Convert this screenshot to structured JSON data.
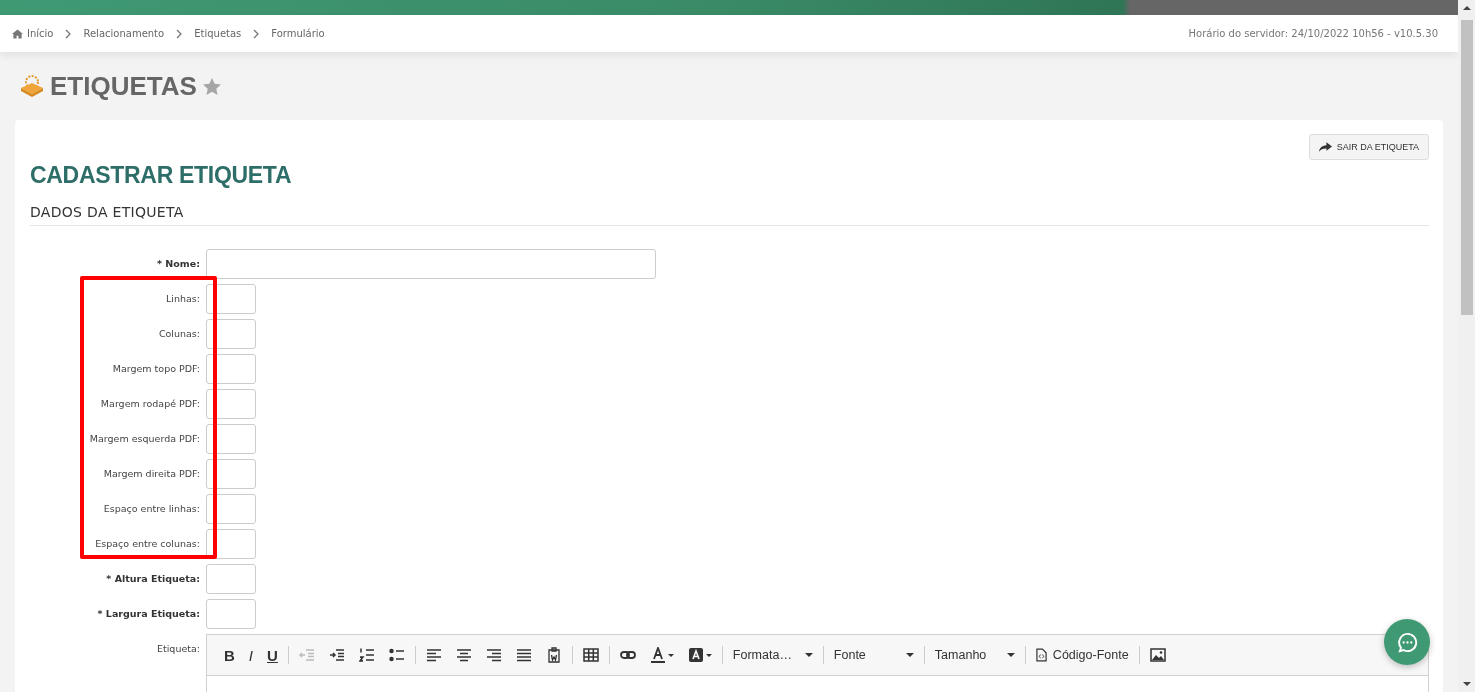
{
  "breadcrumb": [
    {
      "label": "Início",
      "kind": "home"
    },
    {
      "label": "Relacionamento"
    },
    {
      "label": "Etiquetas"
    },
    {
      "label": "Formulário"
    }
  ],
  "server_info": "Horário do servidor: 24/10/2022 10h56 - v10.5.30",
  "page_title": "ETIQUETAS",
  "favorite": false,
  "exit_button": "SAIR DA ETIQUETA",
  "form_title": "CADASTRAR ETIQUETA",
  "section_title": "DADOS DA ETIQUETA",
  "rows": [
    {
      "kind": "wide",
      "label": "* Nome:",
      "required": true
    },
    {
      "kind": "highlight",
      "fields": [
        {
          "label": "Linhas:",
          "required": false
        },
        {
          "label": "Colunas:",
          "required": false
        },
        {
          "label": "Margem topo PDF:",
          "required": false
        },
        {
          "label": "Margem rodapé PDF:",
          "required": false
        },
        {
          "label": "Margem esquerda PDF:",
          "required": false
        },
        {
          "label": "Margem direita PDF:",
          "required": false
        },
        {
          "label": "Espaço entre linhas:",
          "required": false
        },
        {
          "label": "Espaço entre colunas:",
          "required": false
        }
      ]
    },
    {
      "kind": "small",
      "label": "* Altura Etiqueta:",
      "required": true
    },
    {
      "kind": "small",
      "label": "* Largura Etiqueta:",
      "required": true
    },
    {
      "kind": "editor",
      "label": "Etiqueta:",
      "required": false
    }
  ],
  "toolbar": [
    [
      {
        "kind": "bold",
        "text": "B",
        "disabled": false
      },
      {
        "kind": "italic",
        "text": "I",
        "disabled": false
      },
      {
        "kind": "underline",
        "text": "U",
        "disabled": false
      }
    ],
    [
      {
        "kind": "outdent",
        "disabled": true
      },
      {
        "kind": "indent",
        "disabled": false
      },
      {
        "kind": "numbered",
        "disabled": false
      },
      {
        "kind": "bullets",
        "disabled": false
      }
    ],
    [
      {
        "kind": "left",
        "disabled": false
      },
      {
        "kind": "center",
        "disabled": false
      },
      {
        "kind": "right",
        "disabled": false
      },
      {
        "kind": "justify",
        "disabled": false
      },
      {
        "kind": "paste",
        "disabled": false
      }
    ],
    [
      {
        "kind": "table",
        "disabled": false
      }
    ],
    [
      {
        "kind": "link",
        "disabled": false
      },
      {
        "kind": "textcolor",
        "disabled": false
      },
      {
        "kind": "bgcolor",
        "disabled": false
      }
    ],
    [
      {
        "kind": "dropdown",
        "text": "Formata…",
        "disabled": false
      }
    ],
    [
      {
        "kind": "dropdown",
        "text": "Fonte",
        "disabled": false
      }
    ],
    [
      {
        "kind": "dropdown",
        "text": "Tamanho",
        "disabled": false
      }
    ],
    [
      {
        "kind": "source",
        "text": "Código-Fonte",
        "disabled": false
      }
    ],
    [
      {
        "kind": "image",
        "disabled": false
      }
    ]
  ]
}
